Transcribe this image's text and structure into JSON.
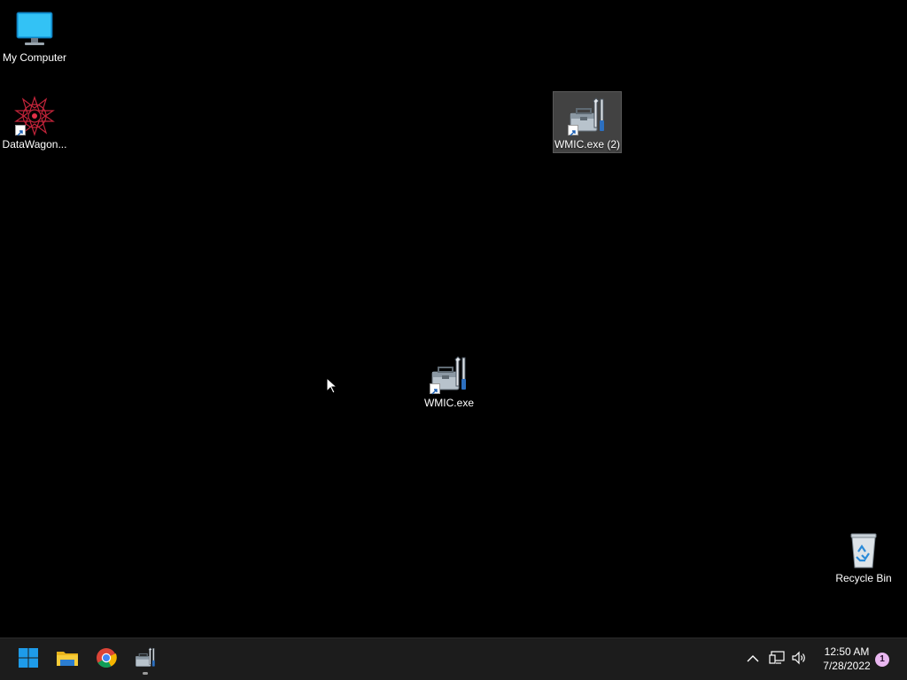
{
  "desktop": {
    "icons": [
      {
        "label": "My Computer",
        "icon": "monitor-icon"
      },
      {
        "label": "DataWagon...",
        "icon": "datawagon-icon"
      },
      {
        "label": "WMIC.exe (2)",
        "icon": "toolbox-icon",
        "selected": true
      },
      {
        "label": "WMIC.exe",
        "icon": "toolbox-icon"
      },
      {
        "label": "Recycle Bin",
        "icon": "recycle-bin-icon"
      }
    ]
  },
  "taskbar": {
    "pinned": [
      {
        "name": "start",
        "icon": "windows-logo-icon"
      },
      {
        "name": "file-explorer",
        "icon": "folder-icon"
      },
      {
        "name": "chrome",
        "icon": "chrome-icon"
      },
      {
        "name": "wmic",
        "icon": "toolbox-icon",
        "running": true
      }
    ],
    "tray": {
      "time": "12:50 AM",
      "date": "7/28/2022",
      "notifications": "1"
    }
  },
  "colors": {
    "desktop_bg": "#000000",
    "taskbar_bg": "#1c1c1c",
    "accent": "#0a84d6",
    "badge": "#e9b7f0"
  }
}
